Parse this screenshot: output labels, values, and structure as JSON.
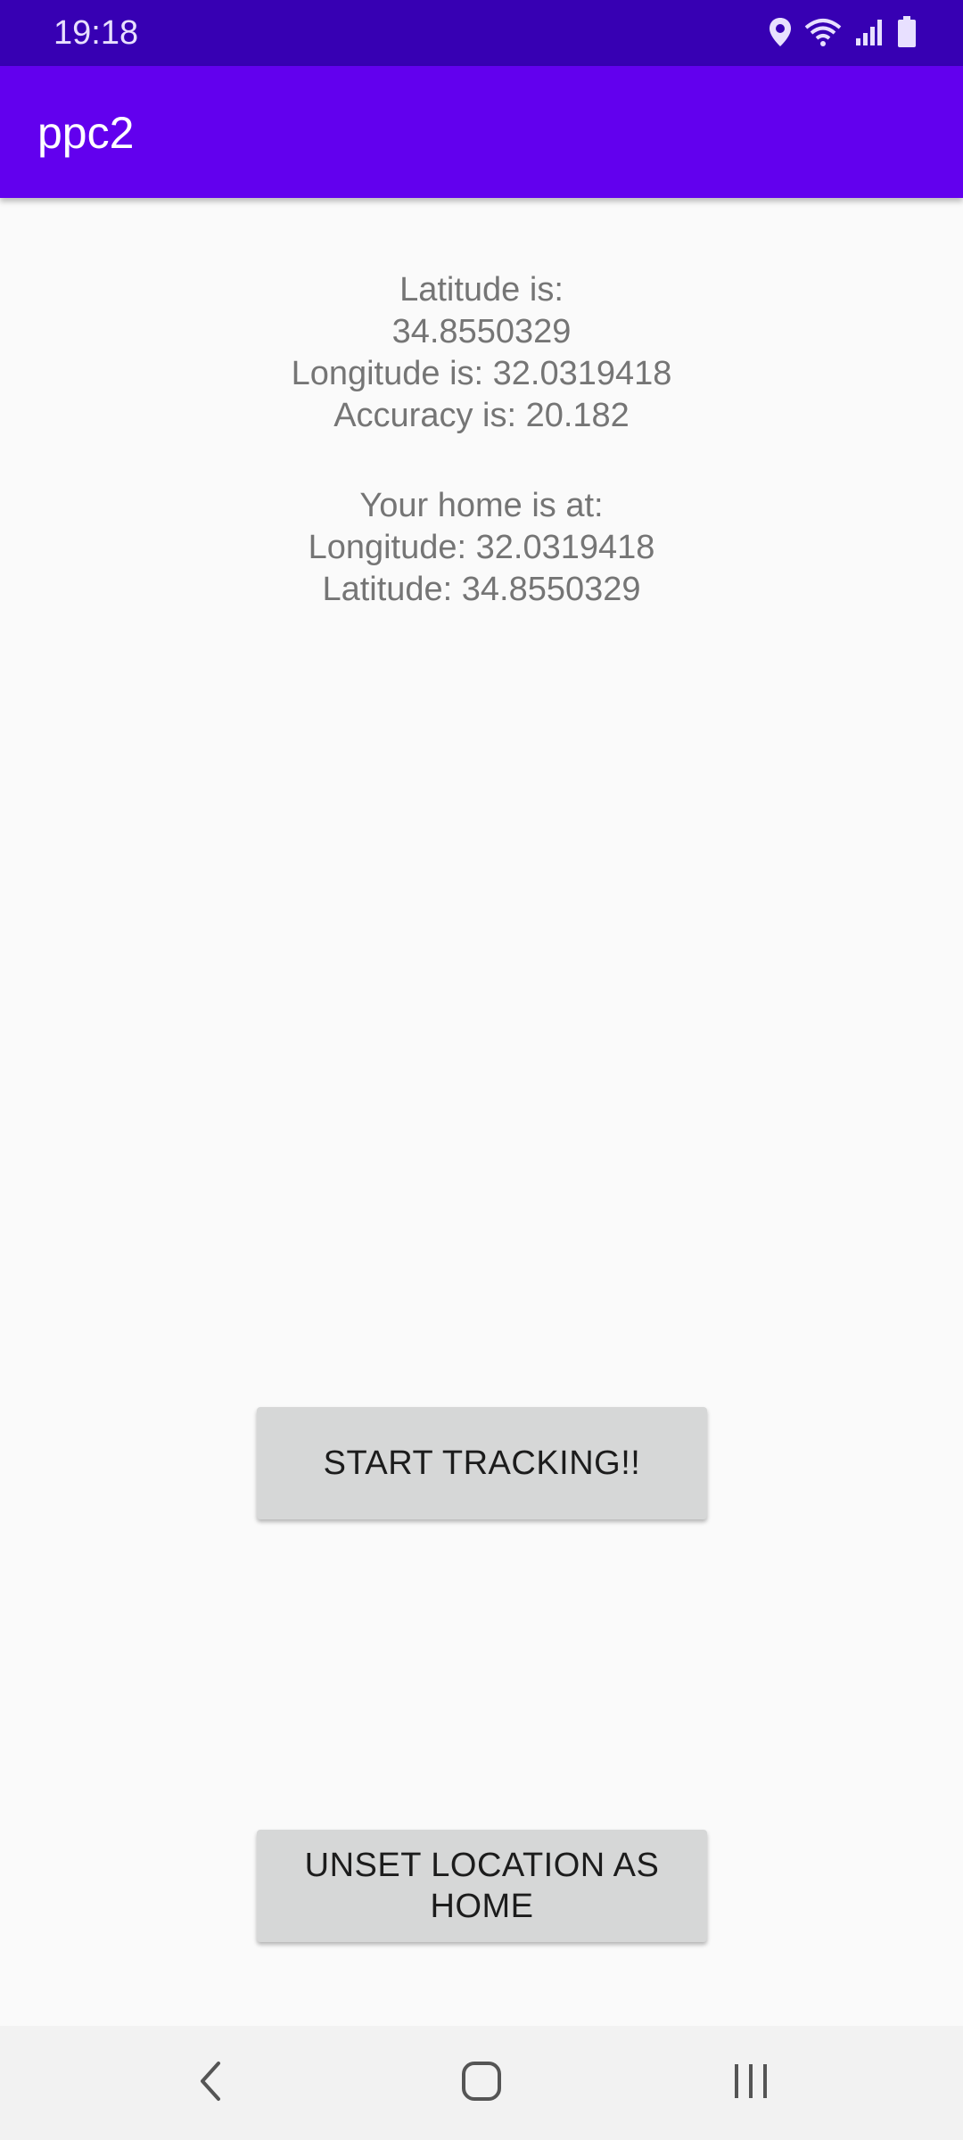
{
  "status_bar": {
    "time": "19:18",
    "icons": [
      "location-icon",
      "wifi-icon",
      "signal-icon",
      "battery-icon"
    ]
  },
  "app_bar": {
    "title": "ppc2"
  },
  "location": {
    "latitude_label": "Latitude is:",
    "latitude_value": "34.8550329",
    "longitude_line": "Longitude is: 32.0319418",
    "accuracy_line": "Accuracy is: 20.182"
  },
  "home": {
    "heading": "Your home is at:",
    "longitude_line": "Longitude: 32.0319418",
    "latitude_line": "Latitude: 34.8550329"
  },
  "buttons": {
    "start_tracking": "START TRACKING!!",
    "unset_home_line1": "UNSET LOCATION AS",
    "unset_home_line2": "HOME"
  },
  "nav_bar": {
    "icons": [
      "back-icon",
      "home-icon",
      "recents-icon"
    ]
  },
  "colors": {
    "status_bar": "#3700b3",
    "app_bar": "#6200ee",
    "background": "#fafafa",
    "button": "#d6d7d7",
    "text_secondary": "#757575"
  }
}
